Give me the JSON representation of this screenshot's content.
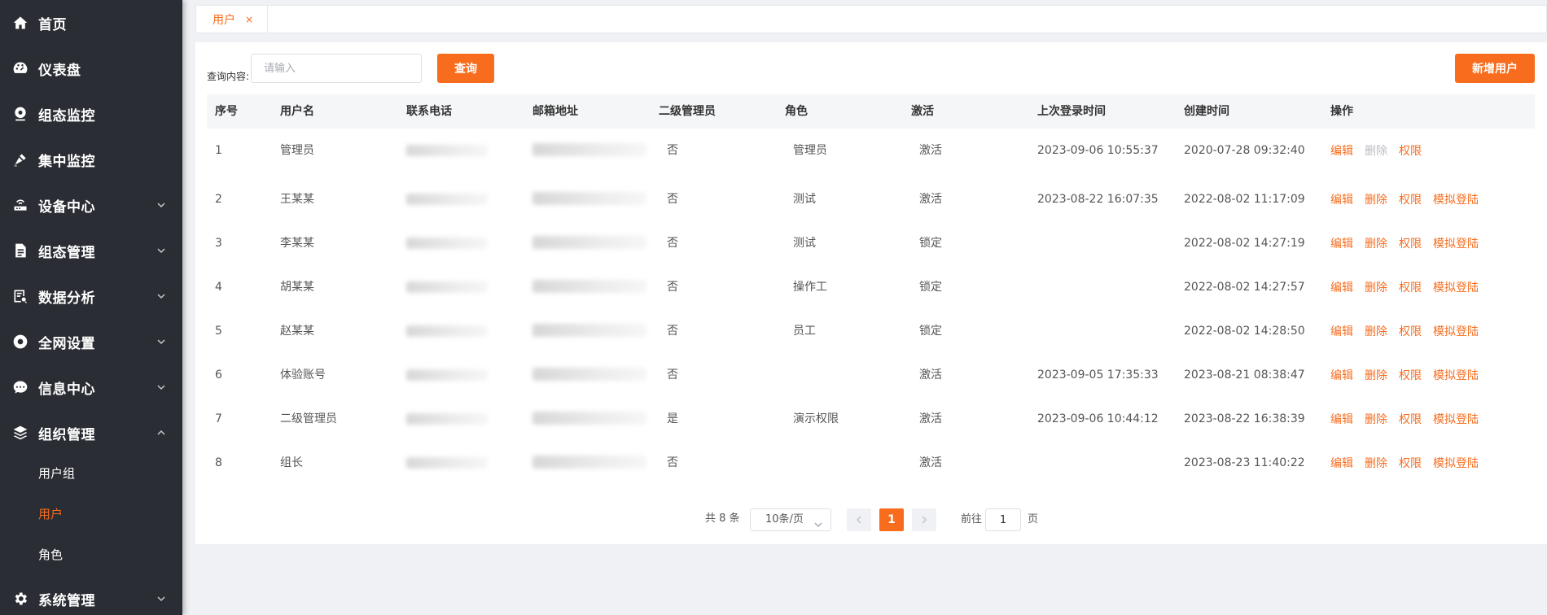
{
  "sidebar": {
    "items": [
      {
        "label": "首页",
        "icon": "home-icon",
        "has_arrow": false
      },
      {
        "label": "仪表盘",
        "icon": "dashboard-icon",
        "has_arrow": false
      },
      {
        "label": "组态监控",
        "icon": "webcam-icon",
        "has_arrow": false
      },
      {
        "label": "集中监控",
        "icon": "broadcast-icon",
        "has_arrow": false
      },
      {
        "label": "设备中心",
        "icon": "router-icon",
        "has_arrow": true,
        "expanded": false
      },
      {
        "label": "组态管理",
        "icon": "document-icon",
        "has_arrow": true,
        "expanded": false
      },
      {
        "label": "数据分析",
        "icon": "report-icon",
        "has_arrow": true,
        "expanded": false
      },
      {
        "label": "全网设置",
        "icon": "circle-setting-icon",
        "has_arrow": true,
        "expanded": false
      },
      {
        "label": "信息中心",
        "icon": "chat-icon",
        "has_arrow": true,
        "expanded": false
      },
      {
        "label": "组织管理",
        "icon": "layers-icon",
        "has_arrow": true,
        "expanded": true
      },
      {
        "label": "系统管理",
        "icon": "gear-icon",
        "has_arrow": true,
        "expanded": false
      }
    ],
    "sub_items": [
      {
        "label": "用户组",
        "active": false
      },
      {
        "label": "用户",
        "active": true
      },
      {
        "label": "角色",
        "active": false
      }
    ]
  },
  "tabs": [
    {
      "label": "用户",
      "close": "×"
    }
  ],
  "search": {
    "label": "查询内容:",
    "placeholder": "请输入",
    "value": "",
    "query_label": "查询",
    "add_label": "新增用户"
  },
  "table": {
    "columns": [
      "序号",
      "用户名",
      "联系电话",
      "邮箱地址",
      "二级管理员",
      "角色",
      "激活",
      "上次登录时间",
      "创建时间",
      "操作"
    ],
    "rows": [
      {
        "no": "1",
        "username": "管理员",
        "admin2": "否",
        "role": "管理员",
        "active": "激活",
        "last_login": "2023-09-06 10:55:37",
        "created": "2020-07-28 09:32:40",
        "ops": [
          "编辑",
          "删除",
          "权限"
        ],
        "delete_disabled": true
      },
      {
        "no": "2",
        "username": "王某某",
        "admin2": "否",
        "role": "测试",
        "active": "激活",
        "last_login": "2023-08-22 16:07:35",
        "created": "2022-08-02 11:17:09",
        "ops": [
          "编辑",
          "删除",
          "权限",
          "模拟登陆"
        ],
        "delete_disabled": false
      },
      {
        "no": "3",
        "username": "李某某",
        "admin2": "否",
        "role": "测试",
        "active": "锁定",
        "last_login": "",
        "created": "2022-08-02 14:27:19",
        "ops": [
          "编辑",
          "删除",
          "权限",
          "模拟登陆"
        ],
        "delete_disabled": false
      },
      {
        "no": "4",
        "username": "胡某某",
        "admin2": "否",
        "role": "操作工",
        "active": "锁定",
        "last_login": "",
        "created": "2022-08-02 14:27:57",
        "ops": [
          "编辑",
          "删除",
          "权限",
          "模拟登陆"
        ],
        "delete_disabled": false
      },
      {
        "no": "5",
        "username": "赵某某",
        "admin2": "否",
        "role": "员工",
        "active": "锁定",
        "last_login": "",
        "created": "2022-08-02 14:28:50",
        "ops": [
          "编辑",
          "删除",
          "权限",
          "模拟登陆"
        ],
        "delete_disabled": false
      },
      {
        "no": "6",
        "username": "体验账号",
        "admin2": "否",
        "role": "",
        "active": "激活",
        "last_login": "2023-09-05 17:35:33",
        "created": "2023-08-21 08:38:47",
        "ops": [
          "编辑",
          "删除",
          "权限",
          "模拟登陆"
        ],
        "delete_disabled": false
      },
      {
        "no": "7",
        "username": "二级管理员",
        "admin2": "是",
        "role": "演示权限",
        "active": "激活",
        "last_login": "2023-09-06 10:44:12",
        "created": "2023-08-22 16:38:39",
        "ops": [
          "编辑",
          "删除",
          "权限",
          "模拟登陆"
        ],
        "delete_disabled": false
      },
      {
        "no": "8",
        "username": "组长",
        "admin2": "否",
        "role": "",
        "active": "激活",
        "last_login": "",
        "created": "2023-08-23 11:40:22",
        "ops": [
          "编辑",
          "删除",
          "权限",
          "模拟登陆"
        ],
        "delete_disabled": false
      }
    ]
  },
  "pagination": {
    "total": "共 8 条",
    "page_size": "10条/页",
    "current_page": "1",
    "goto_label": "前往",
    "goto_value": "1",
    "goto_suffix": "页"
  },
  "colors": {
    "accent": "#f76c1d",
    "sidebar_bg": "#2a2d33",
    "page_bg": "#f0f1f5",
    "disabled": "#b9bcc3"
  }
}
